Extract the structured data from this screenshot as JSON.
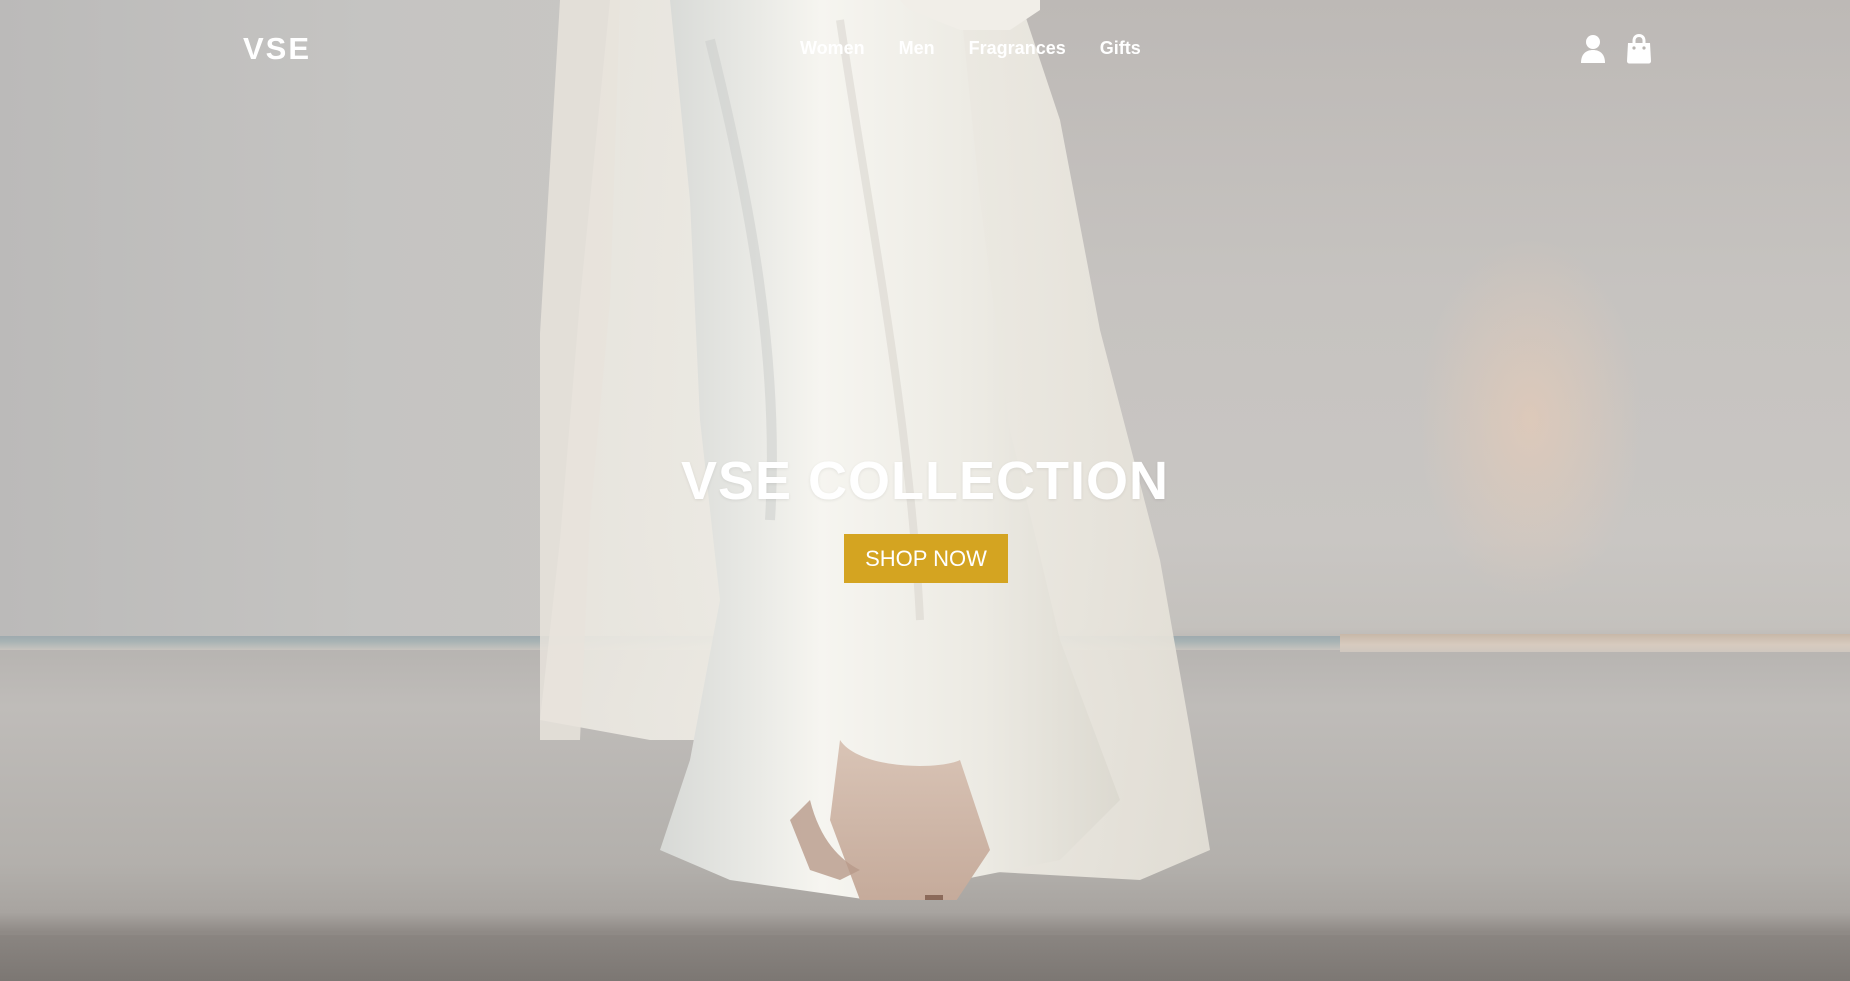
{
  "header": {
    "logo": "VSE",
    "nav": [
      "Women",
      "Men",
      "Fragrances",
      "Gifts"
    ],
    "icons": [
      "user-icon",
      "shopping-bag-icon"
    ]
  },
  "hero": {
    "title": "VSE COLLECTION",
    "button_label": "SHOP NOW",
    "background": "photo: model walking in white satin gown and nude heels on grey floor"
  },
  "colors": {
    "accent": "#d4a421",
    "text": "#ffffff"
  }
}
